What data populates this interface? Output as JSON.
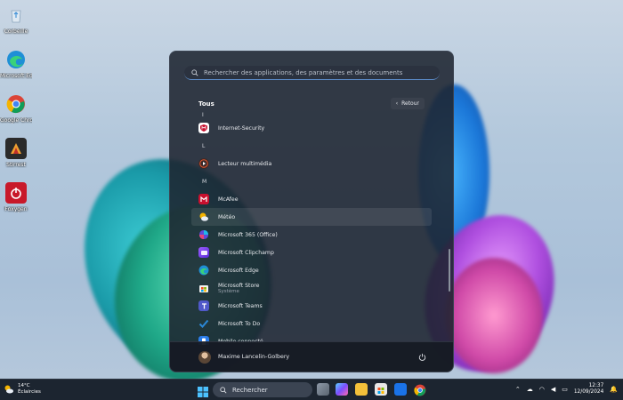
{
  "desktop": {
    "icons": [
      {
        "label": "Corbeille",
        "icon": "recycle-bin-icon"
      },
      {
        "label": "Microsoft Edge",
        "icon": "edge-icon"
      },
      {
        "label": "Google Chrome",
        "icon": "chrome-icon"
      },
      {
        "label": "Stirrest",
        "icon": "app-icon"
      },
      {
        "label": "Foxygen",
        "icon": "power-app-icon"
      }
    ]
  },
  "start_menu": {
    "search_placeholder": "Rechercher des applications, des paramètres et des documents",
    "list_title": "Tous",
    "back_label": "Retour",
    "apps": [
      {
        "type": "letter",
        "text": "I"
      },
      {
        "type": "app",
        "name": "Internet-Security",
        "icon": "mcafee-shield-icon",
        "color": "#c8102e"
      },
      {
        "type": "letter",
        "text": "L"
      },
      {
        "type": "app",
        "name": "Lecteur multimédia",
        "icon": "media-player-icon",
        "color": "#e0542a"
      },
      {
        "type": "letter",
        "text": "M"
      },
      {
        "type": "app",
        "name": "McAfee",
        "icon": "mcafee-icon",
        "color": "#c8102e"
      },
      {
        "type": "app",
        "name": "Météo",
        "icon": "weather-icon",
        "color": "#f4b400",
        "hover": true
      },
      {
        "type": "app",
        "name": "Microsoft 365 (Office)",
        "icon": "office-icon",
        "color": "#6a5acd"
      },
      {
        "type": "app",
        "name": "Microsoft Clipchamp",
        "icon": "clipchamp-icon",
        "color": "#8a4fff"
      },
      {
        "type": "app",
        "name": "Microsoft Edge",
        "icon": "edge-icon",
        "color": "#1fa0d8"
      },
      {
        "type": "app",
        "name": "Microsoft Store",
        "sub": "Système",
        "icon": "store-icon",
        "color": "#1f6fd8"
      },
      {
        "type": "app",
        "name": "Microsoft Teams",
        "icon": "teams-icon",
        "color": "#5059c9"
      },
      {
        "type": "app",
        "name": "Microsoft To Do",
        "icon": "todo-icon",
        "color": "#2564cf"
      },
      {
        "type": "app",
        "name": "Mobile connecté",
        "icon": "phone-link-icon",
        "color": "#2b7de9"
      }
    ],
    "user_name": "Maxime Lancelin-Golbery"
  },
  "taskbar": {
    "weather_temp": "14°C",
    "weather_desc": "Éclaircies",
    "search_label": "Rechercher",
    "time": "12:37",
    "date": "12/09/2024"
  }
}
